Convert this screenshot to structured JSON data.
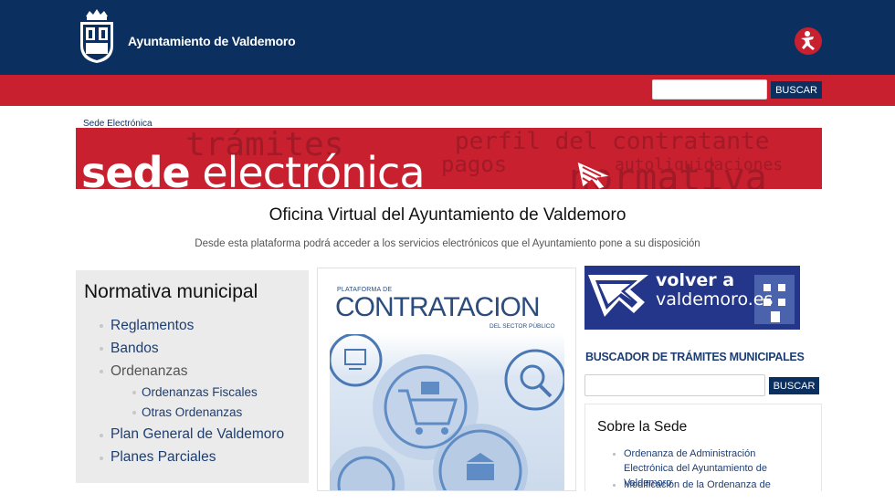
{
  "header": {
    "site_name": "Ayuntamiento de Valdemoro",
    "search_button": "BUSCAR",
    "search_value": "",
    "accent_blue": "#0b2f5e",
    "accent_red": "#c8202f"
  },
  "breadcrumb": "Sede Electrónica",
  "banner": {
    "title_bold": "sede",
    "title_rest": " electrónica",
    "bg_words": [
      "trámites",
      "perfil del contratante",
      "autoliquidaciones",
      "normativa",
      "pagos"
    ]
  },
  "main": {
    "title": "Oficina Virtual del Ayuntamiento de Valdemoro",
    "subtitle": "Desde esta plataforma podrá acceder a los servicios electrónicos que el Ayuntamiento pone a su disposición"
  },
  "normativa": {
    "title": "Normativa municipal",
    "items": [
      {
        "label": "Reglamentos",
        "level": 0
      },
      {
        "label": "Bandos",
        "level": 0
      },
      {
        "label": "Ordenanzas",
        "level": 0
      },
      {
        "label": "Ordenanzas Fiscales",
        "level": 1
      },
      {
        "label": "Otras Ordenanzas",
        "level": 1
      },
      {
        "label": "Plan General de Valdemoro",
        "level": 0
      },
      {
        "label": "Planes Parciales",
        "level": 0
      }
    ]
  },
  "contratacion": {
    "top": "PLATAFORMA DE",
    "big": "CONTRATACION",
    "bottom": "DEL SECTOR PÚBLICO"
  },
  "volver": {
    "line1": "volver a",
    "line2": "valdemoro.es"
  },
  "buscador": {
    "title": "BUSCADOR DE TRÁMITES MUNICIPALES",
    "button": "BUSCAR",
    "value": ""
  },
  "sobre": {
    "title": "Sobre la Sede",
    "items": [
      "Ordenanza de Administración Electrónica del Ayuntamiento de Valdemoro",
      "Modificación de la Ordenanza de"
    ]
  }
}
